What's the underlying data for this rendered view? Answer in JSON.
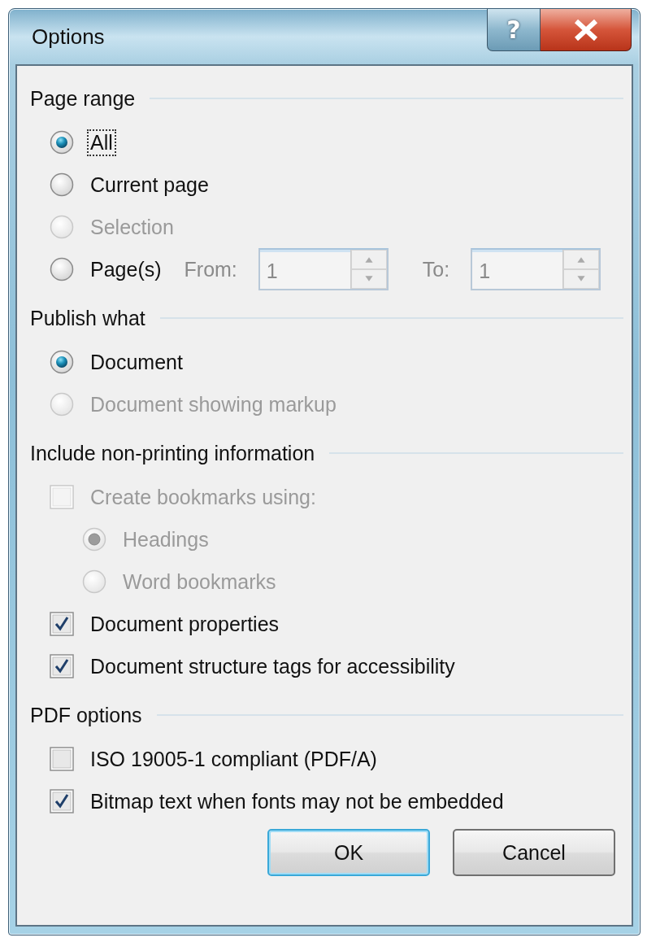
{
  "window": {
    "title": "Options",
    "help_button": {
      "label": "?"
    }
  },
  "sections": [
    {
      "title": "Page range",
      "items": [
        {
          "kind": "radio",
          "label": "All",
          "selected": true,
          "disabled": false,
          "focused": true
        },
        {
          "kind": "radio",
          "label": "Current page",
          "selected": false,
          "disabled": false,
          "focused": false
        },
        {
          "kind": "radio",
          "label": "Selection",
          "selected": false,
          "disabled": true,
          "focused": false
        },
        {
          "kind": "radio",
          "label": "Page(s)",
          "selected": false,
          "disabled": false,
          "focused": false,
          "range": {
            "disabled": true,
            "from_label": "From:",
            "from_value": "1",
            "to_label": "To:",
            "to_value": "1"
          }
        }
      ]
    },
    {
      "title": "Publish what",
      "items": [
        {
          "kind": "radio",
          "label": "Document",
          "selected": true,
          "disabled": false,
          "focused": false
        },
        {
          "kind": "radio",
          "label": "Document showing markup",
          "selected": false,
          "disabled": true,
          "focused": false
        }
      ]
    },
    {
      "title": "Include non-printing information",
      "items": [
        {
          "kind": "checkbox",
          "label": "Create bookmarks using:",
          "checked": false,
          "disabled": true,
          "children": [
            {
              "kind": "radio",
              "label": "Headings",
              "selected": true,
              "disabled": true,
              "focused": false
            },
            {
              "kind": "radio",
              "label": "Word bookmarks",
              "selected": false,
              "disabled": true,
              "focused": false
            }
          ]
        },
        {
          "kind": "checkbox",
          "label": "Document properties",
          "checked": true,
          "disabled": false
        },
        {
          "kind": "checkbox",
          "label": "Document structure tags for accessibility",
          "checked": true,
          "disabled": false
        }
      ]
    },
    {
      "title": "PDF options",
      "items": [
        {
          "kind": "checkbox",
          "label": "ISO 19005-1 compliant (PDF/A)",
          "checked": false,
          "disabled": false
        },
        {
          "kind": "checkbox",
          "label": "Bitmap text when fonts may not be embedded",
          "checked": true,
          "disabled": false
        }
      ]
    }
  ],
  "buttons": [
    {
      "label": "OK",
      "default": true
    },
    {
      "label": "Cancel",
      "default": false
    }
  ]
}
